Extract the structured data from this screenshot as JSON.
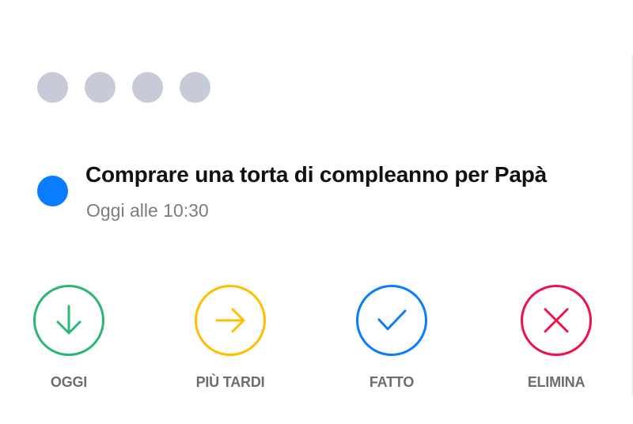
{
  "reminder": {
    "title": "Comprare una torta di compleanno per Papà",
    "time": "Oggi alle 10:30",
    "bullet_color": "#0a7cff"
  },
  "dots_color": "#c7cad8",
  "actions": [
    {
      "label": "OGGI",
      "icon": "arrow-down-icon",
      "color": "#2bb673"
    },
    {
      "label": "PIÙ TARDI",
      "icon": "arrow-right-icon",
      "color": "#ffbf00"
    },
    {
      "label": "FATTO",
      "icon": "checkmark-icon",
      "color": "#0a7cff"
    },
    {
      "label": "ELIMINA",
      "icon": "close-icon",
      "color": "#f0114b"
    }
  ]
}
